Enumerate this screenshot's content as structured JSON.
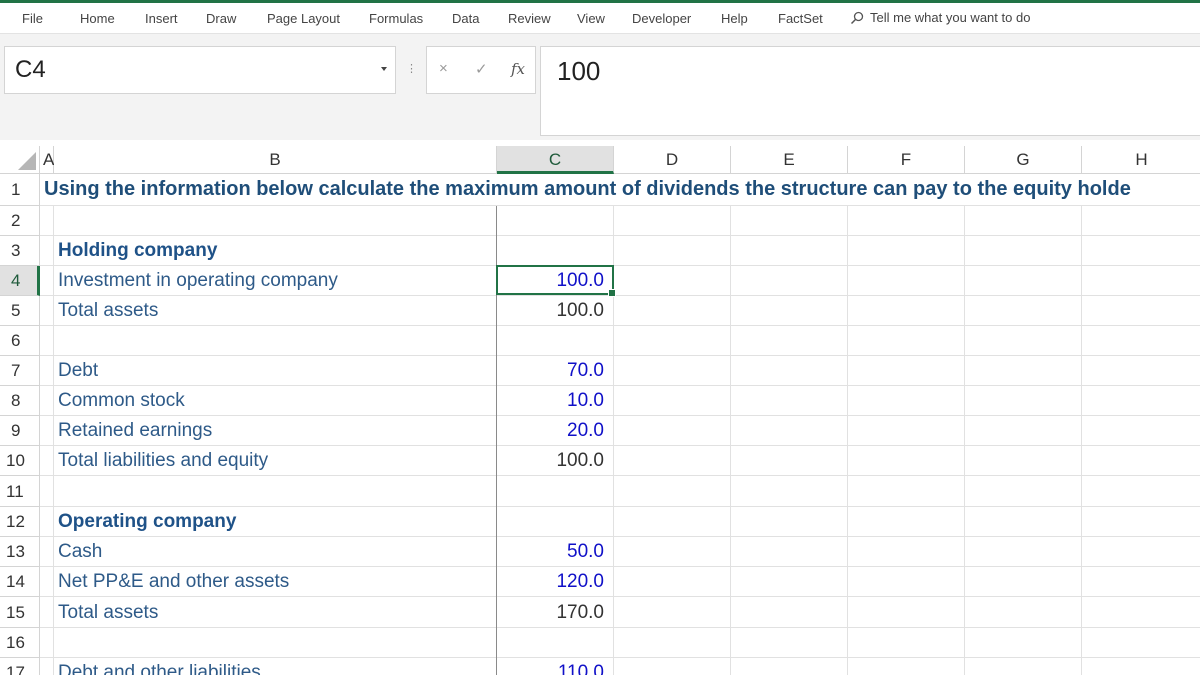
{
  "ribbon": {
    "tabs": [
      "File",
      "Home",
      "Insert",
      "Draw",
      "Page Layout",
      "Formulas",
      "Data",
      "Review",
      "View",
      "Developer",
      "Help",
      "FactSet"
    ],
    "tell_me": "Tell me what you want to do"
  },
  "formula_bar": {
    "name_box": "C4",
    "cancel_icon": "×",
    "enter_icon": "✓",
    "fx_label": "fx",
    "formula": "100"
  },
  "columns": [
    "A",
    "B",
    "C",
    "D",
    "E",
    "F",
    "G",
    "H"
  ],
  "selected_column": "C",
  "selected_row": "4",
  "rows": [
    "1",
    "2",
    "3",
    "4",
    "5",
    "6",
    "7",
    "8",
    "9",
    "10",
    "11",
    "12",
    "13",
    "14",
    "15",
    "16",
    "17"
  ],
  "sheet": {
    "title": "Using the information below calculate the maximum amount of dividends the structure can pay to the equity holde",
    "holding_heading": "Holding company",
    "inv_label": "Investment in operating company",
    "inv_value": "100.0",
    "ta_label": "Total assets",
    "ta_value": "100.0",
    "debt_label": "Debt",
    "debt_value": "70.0",
    "cs_label": "Common stock",
    "cs_value": "10.0",
    "re_label": "Retained earnings",
    "re_value": "20.0",
    "tle_label": "Total liabilities and equity",
    "tle_value": "100.0",
    "operating_heading": "Operating company",
    "cash_label": "Cash",
    "cash_value": "50.0",
    "ppe_label": "Net PP&E and other assets",
    "ppe_value": "120.0",
    "ta2_label": "Total assets",
    "ta2_value": "170.0",
    "dol_label": "Debt and other liabilities",
    "dol_value": "110.0"
  }
}
